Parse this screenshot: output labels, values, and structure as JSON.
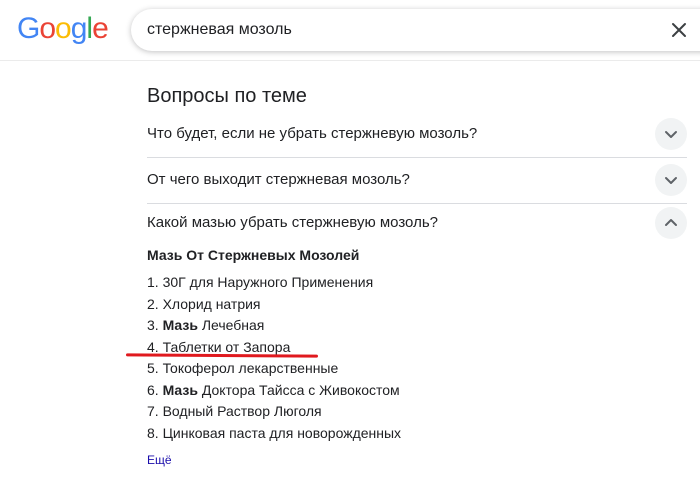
{
  "logo": {
    "text": "Google",
    "letters": [
      {
        "ch": "G",
        "color": "#4285F4"
      },
      {
        "ch": "o",
        "color": "#EA4335"
      },
      {
        "ch": "o",
        "color": "#FBBC05"
      },
      {
        "ch": "g",
        "color": "#4285F4"
      },
      {
        "ch": "l",
        "color": "#34A853"
      },
      {
        "ch": "e",
        "color": "#EA4335"
      }
    ]
  },
  "search": {
    "query": "стержневая мозоль",
    "clear_icon": "close-icon"
  },
  "related_questions": {
    "title": "Вопросы по теме",
    "items": [
      {
        "question": "Что будет, если не убрать стержневую мозоль?",
        "expanded": false,
        "icon": "chevron-down-icon"
      },
      {
        "question": "От чего выходит стержневая мозоль?",
        "expanded": false,
        "icon": "chevron-down-icon"
      },
      {
        "question": "Какой мазью убрать стержневую мозоль?",
        "expanded": true,
        "icon": "chevron-up-icon"
      }
    ],
    "answer": {
      "title": "Мазь От Стержневых Мозолей",
      "list": [
        {
          "num": "1.",
          "bold": "",
          "text": "30Г для Наружного Применения"
        },
        {
          "num": "2.",
          "bold": "",
          "text": "Хлорид натрия"
        },
        {
          "num": "3.",
          "bold": "Мазь",
          "text": "Лечебная"
        },
        {
          "num": "4.",
          "bold": "",
          "text": "Таблетки от Запора"
        },
        {
          "num": "5.",
          "bold": "",
          "text": "Токоферол лекарственные"
        },
        {
          "num": "6.",
          "bold": "Мазь",
          "text": "Доктора Тайсса с Живокостом"
        },
        {
          "num": "7.",
          "bold": "",
          "text": "Водный Раствор Люголя"
        },
        {
          "num": "8.",
          "bold": "",
          "text": "Цинковая паста для новорожденных"
        }
      ],
      "more_label": "Ещё"
    }
  },
  "annotation": {
    "color": "#e0191e",
    "highlighted_item": "Таблетки от Запора"
  }
}
